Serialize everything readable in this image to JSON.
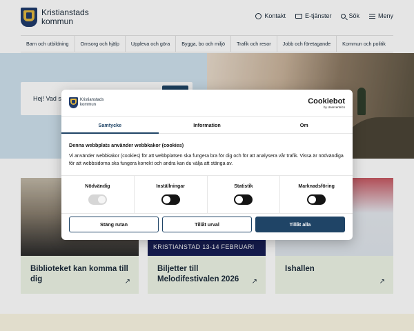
{
  "header": {
    "logo_line1": "Kristianstads",
    "logo_line2": "kommun",
    "links": [
      {
        "label": "Kontakt",
        "icon": "chat-icon"
      },
      {
        "label": "E-tjänster",
        "icon": "monitor-icon"
      },
      {
        "label": "Sök",
        "icon": "search-icon"
      },
      {
        "label": "Meny",
        "icon": "menu-icon"
      }
    ]
  },
  "main_nav": [
    "Barn och utbildning",
    "Omsorg och hjälp",
    "Uppleva och göra",
    "Bygga, bo och miljö",
    "Trafik och resor",
    "Jobb och företagande",
    "Kommun och politik"
  ],
  "hero": {
    "search_greeting": "Hej! Vad sö"
  },
  "cards": [
    {
      "title": "Biblioteket kan komma till dig"
    },
    {
      "title": "Biljetter till Melodifestivalen 2026",
      "banner": "KRISTIANSTAD 13-14 FEBRUARI"
    },
    {
      "title": "Ishallen"
    }
  ],
  "cookie_dialog": {
    "brand_line1": "Kristianstads",
    "brand_line2": "kommun",
    "provider_name": "Cookiebot",
    "provider_sub": "by Usercentrics",
    "tabs": [
      "Samtycke",
      "Information",
      "Om"
    ],
    "active_tab": "Samtycke",
    "heading": "Denna webbplats använder webbkakor (cookies)",
    "text": "Vi använder webbkakor (cookies) för att webbplatsen ska fungera bra för dig och för att analysera vår trafik. Vissa är nödvändiga för att webbsidorna ska fungera korrekt och andra kan du välja att stänga av.",
    "toggles": [
      {
        "label": "Nödvändig",
        "state": "disabled-on"
      },
      {
        "label": "Inställningar",
        "state": "off"
      },
      {
        "label": "Statistik",
        "state": "off"
      },
      {
        "label": "Marknadsföring",
        "state": "off"
      }
    ],
    "buttons": [
      "Stäng rutan",
      "Tillåt urval",
      "Tillåt alla"
    ]
  },
  "colors": {
    "primary": "#1f4466",
    "card_bg": "#eef4e6",
    "hero_left": "#cfe1ee"
  }
}
